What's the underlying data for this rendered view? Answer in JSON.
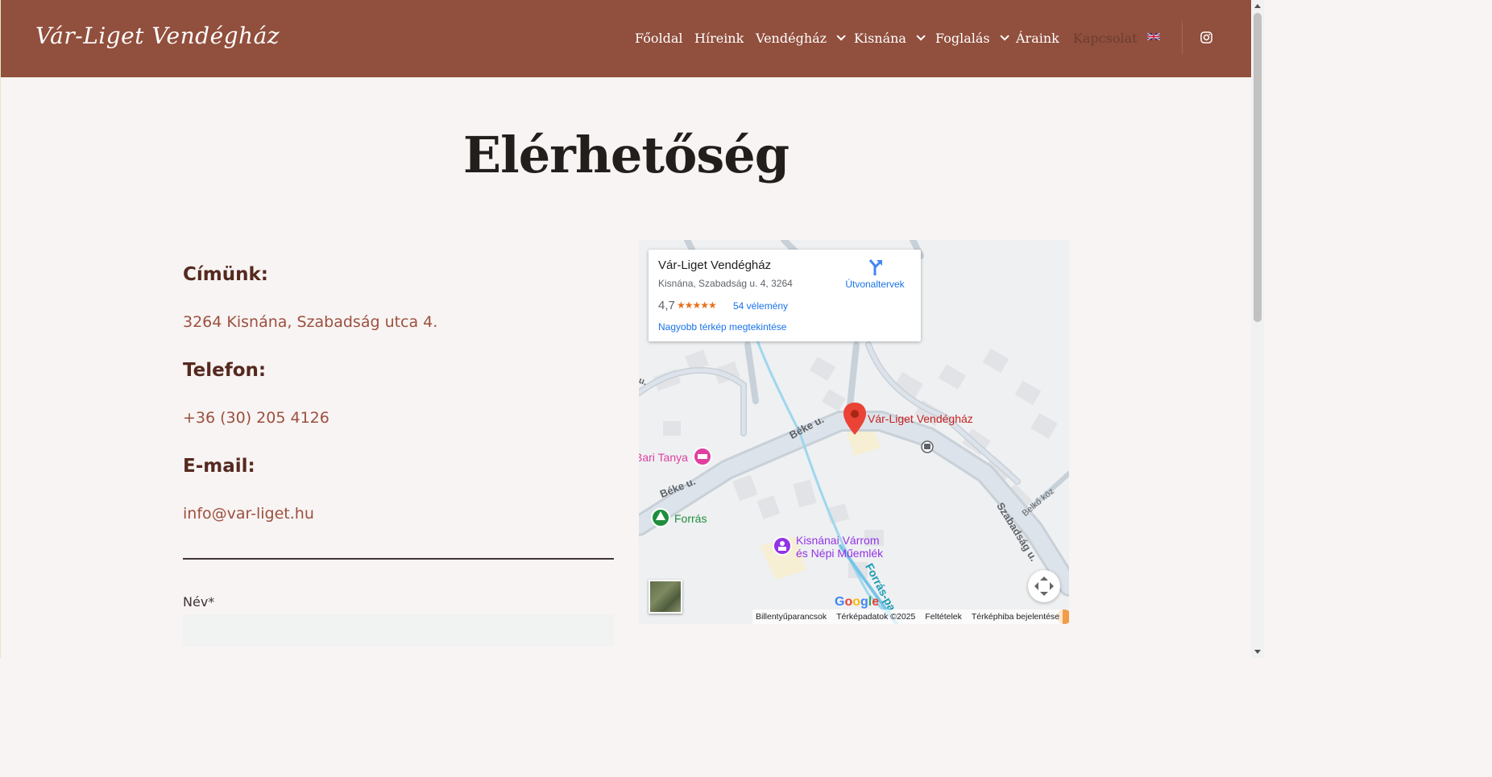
{
  "header": {
    "logo": "Vár-Liget Vendégház",
    "nav": [
      {
        "label": "Főoldal"
      },
      {
        "label": "Híreink"
      },
      {
        "label": "Vendégház"
      },
      {
        "label": "Kisnána"
      },
      {
        "label": "Foglalás"
      },
      {
        "label": "Áraink"
      },
      {
        "label": "Kapcsolat"
      }
    ],
    "icons": [
      "uk-flag-icon",
      "instagram-icon"
    ]
  },
  "page": {
    "title": "Elérhetőség"
  },
  "contact": {
    "address_label": "Címünk:",
    "address": "3264 Kisnána, Szabadság utca 4.",
    "phone_label": "Telefon:",
    "phone": "+36 (30) 205 4126",
    "email_label": "E-mail:",
    "email": "info@var-liget.hu"
  },
  "form": {
    "name_label": "Név*",
    "name_value": ""
  },
  "map": {
    "card": {
      "title": "Vár-Liget Vendégház",
      "address": "Kisnána, Szabadság u. 4, 3264",
      "rating": "4,7",
      "stars": "★★★★★",
      "reviews": "54 vélemény",
      "bigger_map": "Nagyobb térkép megtekintése",
      "directions": "Útvonaltervek"
    },
    "labels": {
      "marker": "Vár-Liget Vendégház",
      "beke1": "Béke u.",
      "beke2": "Béke u.",
      "szabadsag": "Szabadság u.",
      "belko": "Belkő köz",
      "forras_patak": "Forrás-pa",
      "tanya": "Bari Tanya",
      "forras": "Forrás",
      "varrom1": "Kisnánai Várrom",
      "varrom2": "és Népi Műemlék",
      "cut_road": "u."
    },
    "google": "Google",
    "attribution": {
      "shortcuts": "Billentyűparancsok",
      "data": "Térképadatok ©2025",
      "terms": "Feltételek",
      "report": "Térképhiba bejelentése"
    },
    "colors": {
      "marker": "#ea4335",
      "tanya": "#e040a0",
      "forras": "#1e8e3e",
      "varrom": "#9334e6"
    }
  }
}
